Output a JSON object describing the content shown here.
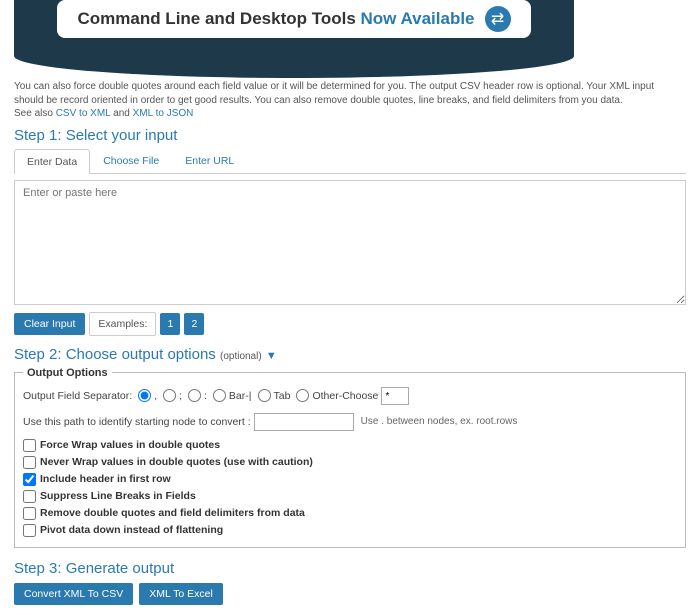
{
  "banner": {
    "text_a": "Command Line and Desktop Tools ",
    "text_b": "Now Available",
    "icon_glyph": "⇄"
  },
  "intro": {
    "line1_a": "You can also force double quotes around each field value or it will be determined for you. The output CSV header row is optional. Your XML input should be record oriented in order to get good results. You can also remove double quotes, line breaks, and field delimiters from you data.",
    "line2_prefix": "See also ",
    "link1": "CSV to XML",
    "mid": " and ",
    "link2": "XML to JSON"
  },
  "step1": {
    "title": "Step 1: Select your input",
    "tabs": {
      "enter_data": "Enter Data",
      "choose_file": "Choose File",
      "enter_url": "Enter URL"
    },
    "placeholder": "Enter or paste here",
    "clear": "Clear Input",
    "examples_label": "Examples:",
    "ex1": "1",
    "ex2": "2"
  },
  "step2": {
    "title": "Step 2: Choose output options ",
    "optional": "(optional)",
    "legend": "Output Options",
    "separator_label": "Output Field Separator:",
    "sep": {
      "comma": ",",
      "semi": ";",
      "colon": ":",
      "bar": "Bar-|",
      "tab": "Tab",
      "other": "Other-Choose"
    },
    "path_label": "Use this path to identify starting node to convert :",
    "path_hint": "Use . between nodes, ex. root.rows",
    "chk": {
      "force": "Force Wrap values in double quotes",
      "never": "Never Wrap values in double quotes (use with caution)",
      "header": "Include header in first row",
      "suppress": "Suppress Line Breaks in Fields",
      "remove": "Remove double quotes and field delimiters from data",
      "pivot": "Pivot data down instead of flattening"
    }
  },
  "step3": {
    "title": "Step 3: Generate output",
    "csv": "Convert XML To CSV",
    "excel": "XML To Excel"
  }
}
